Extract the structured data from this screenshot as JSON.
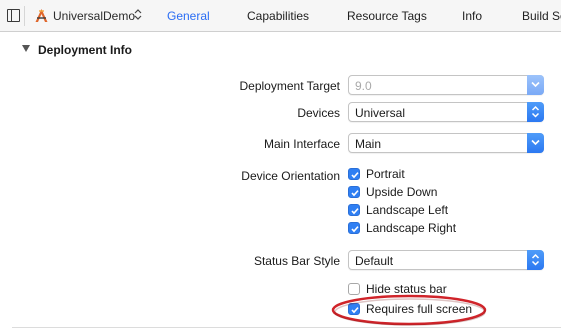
{
  "toolbar": {
    "target_name": "UniversalDemo",
    "tabs": [
      {
        "label": "General",
        "active": true
      },
      {
        "label": "Capabilities",
        "active": false
      },
      {
        "label": "Resource Tags",
        "active": false
      },
      {
        "label": "Info",
        "active": false
      },
      {
        "label": "Build Se",
        "active": false
      }
    ]
  },
  "section": {
    "title": "Deployment Info",
    "deployment_target": {
      "label": "Deployment Target",
      "value": "9.0",
      "enabled": false
    },
    "devices": {
      "label": "Devices",
      "value": "Universal"
    },
    "main_interface": {
      "label": "Main Interface",
      "value": "Main"
    },
    "device_orientation": {
      "label": "Device Orientation",
      "options": [
        {
          "label": "Portrait",
          "checked": true
        },
        {
          "label": "Upside Down",
          "checked": true
        },
        {
          "label": "Landscape Left",
          "checked": true
        },
        {
          "label": "Landscape Right",
          "checked": true
        }
      ]
    },
    "status_bar_style": {
      "label": "Status Bar Style",
      "value": "Default"
    },
    "hide_status_bar": {
      "label": "Hide status bar",
      "checked": false
    },
    "requires_full_screen": {
      "label": "Requires full screen",
      "checked": true
    }
  },
  "colors": {
    "accent": "#2a6df4",
    "checkbox_fill": "#2f7ff3",
    "highlight": "#d0242a"
  }
}
